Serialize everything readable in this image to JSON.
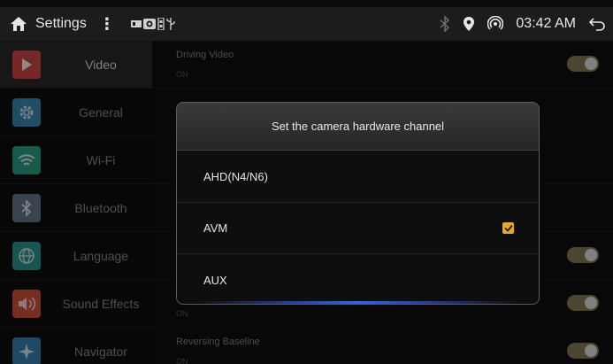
{
  "statusbar": {
    "title": "Settings",
    "more": "⋮",
    "time": "03:42 AM",
    "icons": [
      "home-icon",
      "more-vert-icon",
      "media-icon",
      "camera-icon",
      "usb-icon",
      "bluetooth-icon",
      "location-icon",
      "hotspot-icon",
      "back-icon"
    ]
  },
  "sidebar": {
    "items": [
      {
        "label": "Video",
        "icon": "play-icon",
        "color": "#d84a4a",
        "active": true
      },
      {
        "label": "General",
        "icon": "gear-icon",
        "color": "#3a8fb8"
      },
      {
        "label": "Wi-Fi",
        "icon": "wifi-icon",
        "color": "#2aa58a"
      },
      {
        "label": "Bluetooth",
        "icon": "bluetooth-icon",
        "color": "#6a7c8e"
      },
      {
        "label": "Language",
        "icon": "globe-icon",
        "color": "#2f9c95"
      },
      {
        "label": "Sound Effects",
        "icon": "speaker-icon",
        "color": "#d8543a"
      },
      {
        "label": "Navigator",
        "icon": "compass-icon",
        "color": "#3a86b8"
      }
    ]
  },
  "main": {
    "rows": [
      {
        "title": "Driving Video",
        "sub": "ON",
        "toggle": true
      },
      {
        "title": "",
        "sub": "",
        "toggle": false
      },
      {
        "title": "",
        "sub": "",
        "toggle": false
      },
      {
        "title": "",
        "sub": "",
        "toggle": false
      },
      {
        "title": "",
        "sub": "",
        "toggle": true
      },
      {
        "title": "",
        "sub": "ON",
        "toggle": true
      },
      {
        "title": "Reversing Baseline",
        "sub": "ON",
        "toggle": true
      }
    ]
  },
  "dialog": {
    "title": "Set the camera hardware channel",
    "options": [
      {
        "label": "AHD(N4/N6)",
        "checked": false
      },
      {
        "label": "AVM",
        "checked": true
      },
      {
        "label": "AUX",
        "checked": false
      }
    ]
  },
  "colors": {
    "accent": "#e5a92a",
    "toggle_on": "#8a7f58"
  }
}
